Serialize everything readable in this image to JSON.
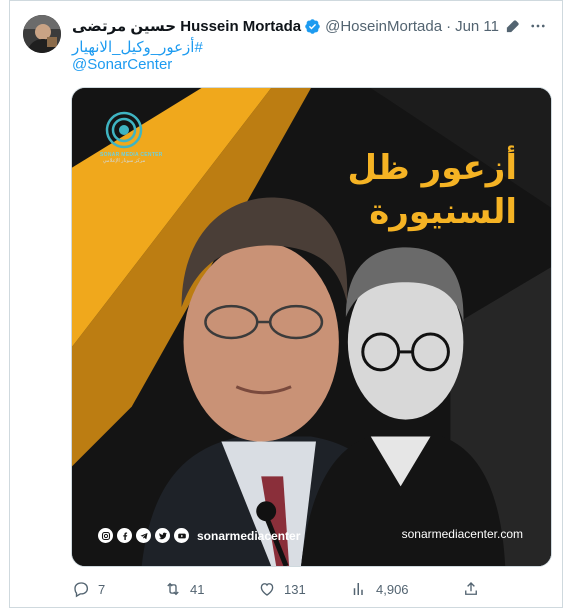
{
  "tweet": {
    "display_name_ar": "حسين مرتضى",
    "display_name_en": "Hussein Mortada",
    "handle": "@HoseinMortada",
    "separator": "·",
    "date": "Jun 11",
    "hashtag": "#أزعور_وكيل_الانهيار",
    "mention": "@SonarCenter"
  },
  "media": {
    "headline_line1": "أزعور ظل",
    "headline_line2": "السنيورة",
    "logo_name": "SONAR MEDIA CENTER",
    "logo_sub": "مركز سونار الإعلامي",
    "social_handle": "sonarmediacenter",
    "site": "sonarmediacenter.com",
    "social_icons": [
      "instagram-icon",
      "facebook-icon",
      "telegram-icon",
      "twitter-icon",
      "youtube-icon"
    ]
  },
  "actions": {
    "replies": "7",
    "retweets": "41",
    "likes": "131",
    "views": "4,906"
  },
  "colors": {
    "accent": "#1d9bf0",
    "headline": "#f5b324",
    "muted": "#536471"
  }
}
